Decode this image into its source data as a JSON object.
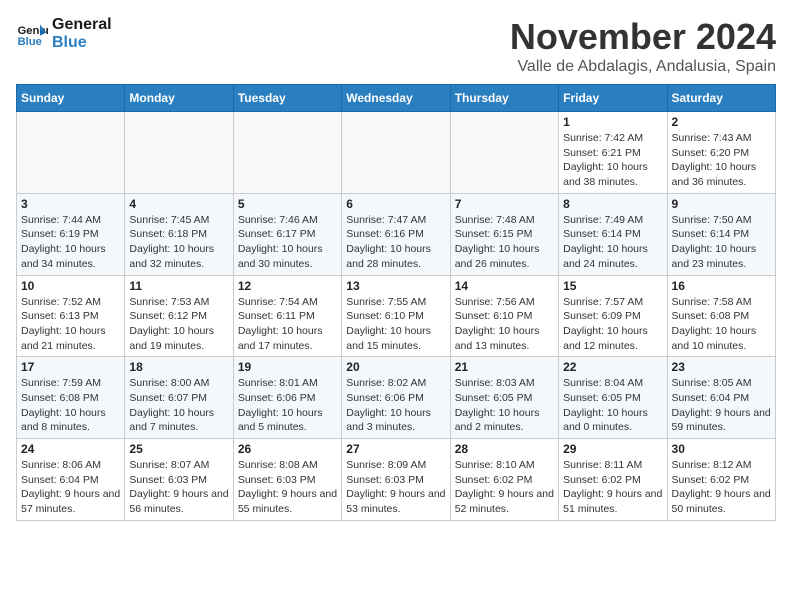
{
  "header": {
    "logo_line1": "General",
    "logo_line2": "Blue",
    "month_title": "November 2024",
    "location": "Valle de Abdalagis, Andalusia, Spain"
  },
  "weekdays": [
    "Sunday",
    "Monday",
    "Tuesday",
    "Wednesday",
    "Thursday",
    "Friday",
    "Saturday"
  ],
  "weeks": [
    [
      {
        "day": "",
        "info": ""
      },
      {
        "day": "",
        "info": ""
      },
      {
        "day": "",
        "info": ""
      },
      {
        "day": "",
        "info": ""
      },
      {
        "day": "",
        "info": ""
      },
      {
        "day": "1",
        "info": "Sunrise: 7:42 AM\nSunset: 6:21 PM\nDaylight: 10 hours and 38 minutes."
      },
      {
        "day": "2",
        "info": "Sunrise: 7:43 AM\nSunset: 6:20 PM\nDaylight: 10 hours and 36 minutes."
      }
    ],
    [
      {
        "day": "3",
        "info": "Sunrise: 7:44 AM\nSunset: 6:19 PM\nDaylight: 10 hours and 34 minutes."
      },
      {
        "day": "4",
        "info": "Sunrise: 7:45 AM\nSunset: 6:18 PM\nDaylight: 10 hours and 32 minutes."
      },
      {
        "day": "5",
        "info": "Sunrise: 7:46 AM\nSunset: 6:17 PM\nDaylight: 10 hours and 30 minutes."
      },
      {
        "day": "6",
        "info": "Sunrise: 7:47 AM\nSunset: 6:16 PM\nDaylight: 10 hours and 28 minutes."
      },
      {
        "day": "7",
        "info": "Sunrise: 7:48 AM\nSunset: 6:15 PM\nDaylight: 10 hours and 26 minutes."
      },
      {
        "day": "8",
        "info": "Sunrise: 7:49 AM\nSunset: 6:14 PM\nDaylight: 10 hours and 24 minutes."
      },
      {
        "day": "9",
        "info": "Sunrise: 7:50 AM\nSunset: 6:14 PM\nDaylight: 10 hours and 23 minutes."
      }
    ],
    [
      {
        "day": "10",
        "info": "Sunrise: 7:52 AM\nSunset: 6:13 PM\nDaylight: 10 hours and 21 minutes."
      },
      {
        "day": "11",
        "info": "Sunrise: 7:53 AM\nSunset: 6:12 PM\nDaylight: 10 hours and 19 minutes."
      },
      {
        "day": "12",
        "info": "Sunrise: 7:54 AM\nSunset: 6:11 PM\nDaylight: 10 hours and 17 minutes."
      },
      {
        "day": "13",
        "info": "Sunrise: 7:55 AM\nSunset: 6:10 PM\nDaylight: 10 hours and 15 minutes."
      },
      {
        "day": "14",
        "info": "Sunrise: 7:56 AM\nSunset: 6:10 PM\nDaylight: 10 hours and 13 minutes."
      },
      {
        "day": "15",
        "info": "Sunrise: 7:57 AM\nSunset: 6:09 PM\nDaylight: 10 hours and 12 minutes."
      },
      {
        "day": "16",
        "info": "Sunrise: 7:58 AM\nSunset: 6:08 PM\nDaylight: 10 hours and 10 minutes."
      }
    ],
    [
      {
        "day": "17",
        "info": "Sunrise: 7:59 AM\nSunset: 6:08 PM\nDaylight: 10 hours and 8 minutes."
      },
      {
        "day": "18",
        "info": "Sunrise: 8:00 AM\nSunset: 6:07 PM\nDaylight: 10 hours and 7 minutes."
      },
      {
        "day": "19",
        "info": "Sunrise: 8:01 AM\nSunset: 6:06 PM\nDaylight: 10 hours and 5 minutes."
      },
      {
        "day": "20",
        "info": "Sunrise: 8:02 AM\nSunset: 6:06 PM\nDaylight: 10 hours and 3 minutes."
      },
      {
        "day": "21",
        "info": "Sunrise: 8:03 AM\nSunset: 6:05 PM\nDaylight: 10 hours and 2 minutes."
      },
      {
        "day": "22",
        "info": "Sunrise: 8:04 AM\nSunset: 6:05 PM\nDaylight: 10 hours and 0 minutes."
      },
      {
        "day": "23",
        "info": "Sunrise: 8:05 AM\nSunset: 6:04 PM\nDaylight: 9 hours and 59 minutes."
      }
    ],
    [
      {
        "day": "24",
        "info": "Sunrise: 8:06 AM\nSunset: 6:04 PM\nDaylight: 9 hours and 57 minutes."
      },
      {
        "day": "25",
        "info": "Sunrise: 8:07 AM\nSunset: 6:03 PM\nDaylight: 9 hours and 56 minutes."
      },
      {
        "day": "26",
        "info": "Sunrise: 8:08 AM\nSunset: 6:03 PM\nDaylight: 9 hours and 55 minutes."
      },
      {
        "day": "27",
        "info": "Sunrise: 8:09 AM\nSunset: 6:03 PM\nDaylight: 9 hours and 53 minutes."
      },
      {
        "day": "28",
        "info": "Sunrise: 8:10 AM\nSunset: 6:02 PM\nDaylight: 9 hours and 52 minutes."
      },
      {
        "day": "29",
        "info": "Sunrise: 8:11 AM\nSunset: 6:02 PM\nDaylight: 9 hours and 51 minutes."
      },
      {
        "day": "30",
        "info": "Sunrise: 8:12 AM\nSunset: 6:02 PM\nDaylight: 9 hours and 50 minutes."
      }
    ]
  ]
}
